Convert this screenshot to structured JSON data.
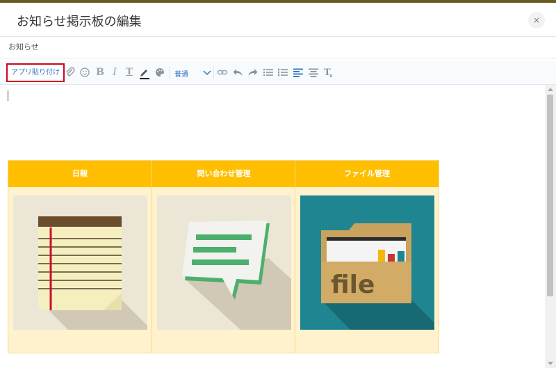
{
  "modal": {
    "title": "お知らせ掲示板の編集",
    "close_label": "×"
  },
  "subject": {
    "value": "お知らせ"
  },
  "toolbar": {
    "app_paste_label": "アプリ貼り付け",
    "format_select": "普通",
    "icons": [
      "attachment-icon",
      "emoji-icon",
      "bold-icon",
      "italic-icon",
      "text-format-icon",
      "highlight-icon",
      "color-palette-icon",
      "link-icon",
      "undo-icon",
      "redo-icon",
      "bullet-list-icon",
      "numbered-list-icon",
      "align-left-icon",
      "align-center-icon",
      "clear-format-icon"
    ]
  },
  "colors": {
    "header_bg": "#ffbf00",
    "table_bg": "#fff2cc",
    "accent": "#2f74c0",
    "highlight_border": "#d0021b"
  },
  "app_table": {
    "columns": [
      {
        "title": "日報",
        "icon": "notepad-icon"
      },
      {
        "title": "問い合わせ管理",
        "icon": "speech-bubble-icon"
      },
      {
        "title": "ファイル管理",
        "icon": "file-folder-icon",
        "icon_text": "file"
      }
    ]
  }
}
